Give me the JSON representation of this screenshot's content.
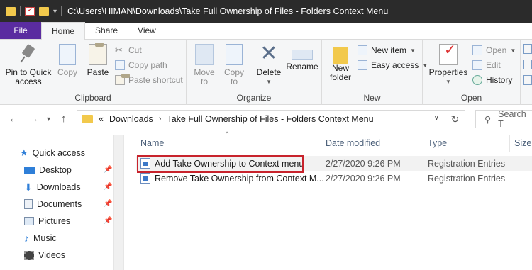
{
  "titlebar": {
    "path": "C:\\Users\\HIMAN\\Downloads\\Take Full Ownership of Files - Folders Context Menu"
  },
  "tabs": {
    "file": "File",
    "home": "Home",
    "share": "Share",
    "view": "View"
  },
  "ribbon": {
    "clipboard": {
      "label": "Clipboard",
      "pin": "Pin to Quick access",
      "pin_line1": "Pin to Quick",
      "pin_line2": "access",
      "copy": "Copy",
      "paste": "Paste",
      "cut": "Cut",
      "copy_path": "Copy path",
      "paste_shortcut": "Paste shortcut"
    },
    "organize": {
      "label": "Organize",
      "move_to_line1": "Move",
      "move_to_line2": "to",
      "copy_to_line1": "Copy",
      "copy_to_line2": "to",
      "delete": "Delete",
      "rename": "Rename"
    },
    "new": {
      "label": "New",
      "new_folder_line1": "New",
      "new_folder_line2": "folder",
      "new_item": "New item",
      "easy_access": "Easy access"
    },
    "open": {
      "label": "Open",
      "properties": "Properties",
      "open": "Open",
      "edit": "Edit",
      "history": "History"
    }
  },
  "address": {
    "overflow": "«",
    "crumb1": "Downloads",
    "crumb2": "Take Full Ownership of Files - Folders Context Menu",
    "search_placeholder": "Search T"
  },
  "nav": {
    "quick_access": "Quick access",
    "items": [
      "Desktop",
      "Downloads",
      "Documents",
      "Pictures",
      "Music",
      "Videos"
    ]
  },
  "columns": {
    "name": "Name",
    "date": "Date modified",
    "type": "Type",
    "size": "Size"
  },
  "files": [
    {
      "name": "Add Take Ownership to Context menu",
      "date": "2/27/2020 9:26 PM",
      "type": "Registration Entries"
    },
    {
      "name": "Remove Take Ownership from Context M...",
      "date": "2/27/2020 9:26 PM",
      "type": "Registration Entries"
    }
  ],
  "colors": {
    "file_tab": "#5a2ca0",
    "highlight_border": "#c8232c",
    "titlebar": "#2b2b2b"
  }
}
